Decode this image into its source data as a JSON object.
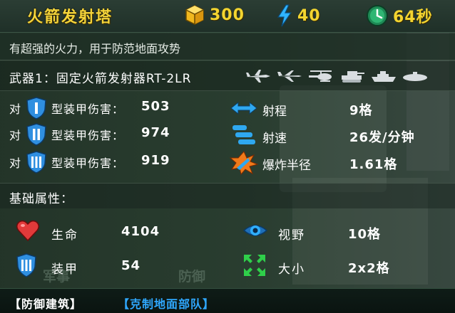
{
  "header": {
    "title": "火箭发射塔",
    "cost": "300",
    "power": "40",
    "build_time": "64秒"
  },
  "description": "有超强的火力，用于防范地面攻势",
  "weapon": {
    "label": "武器1：固定火箭发射器RT-2LR",
    "targets": [
      "fighter-plane-icon",
      "jet-icon",
      "helicopter-icon",
      "tank-icon",
      "ship-icon",
      "submarine-icon"
    ]
  },
  "damage": [
    {
      "prefix": "对",
      "armor_class": "I",
      "label": "型装甲伤害：",
      "value": "503"
    },
    {
      "prefix": "对",
      "armor_class": "II",
      "label": "型装甲伤害：",
      "value": "974"
    },
    {
      "prefix": "对",
      "armor_class": "III",
      "label": "型装甲伤害：",
      "value": "919"
    }
  ],
  "weapon_stats": [
    {
      "icon": "range-arrows-icon",
      "label": "射程",
      "value": "9格"
    },
    {
      "icon": "fire-rate-icon",
      "label": "射速",
      "value": "26发/分钟"
    },
    {
      "icon": "explosion-icon",
      "label": "爆炸半径",
      "value": "1.61格"
    }
  ],
  "basic_section_title": "基础属性：",
  "attributes": {
    "hp": {
      "label": "生命",
      "value": "4104"
    },
    "armor": {
      "label": "装甲",
      "value": "54"
    },
    "vision": {
      "label": "视野",
      "value": "10格"
    },
    "size": {
      "label": "大小",
      "value": "2x2格"
    }
  },
  "background_tabs": [
    "军事",
    "防御"
  ],
  "tags": [
    "【防御建筑】",
    "【克制地面部队】"
  ],
  "colors": {
    "title": "#f4d43a",
    "resource_value": "#f3d530",
    "counter_tag": "#2fa8ff",
    "shield": "#2f8fe0",
    "heart": "#e23a3a",
    "size_icon": "#2fcf4a"
  }
}
